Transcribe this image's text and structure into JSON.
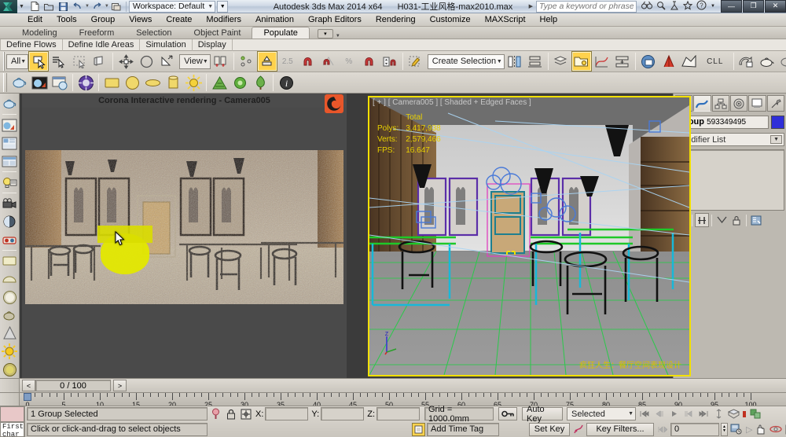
{
  "titlebar": {
    "app_title": "Autodesk 3ds Max  2014 x64",
    "file_name": "H031-工业风格-max2010.max",
    "workspace_label": "Workspace: Default",
    "search_placeholder": "Type a keyword or phrase",
    "quick_access": [
      {
        "name": "new-file-icon",
        "glyph": "🗋"
      },
      {
        "name": "open-file-icon",
        "glyph": "🗁"
      },
      {
        "name": "save-file-icon",
        "glyph": "💾"
      },
      {
        "name": "undo-icon",
        "glyph": "↰"
      },
      {
        "name": "redo-icon",
        "glyph": "↱"
      },
      {
        "name": "project-folder-icon",
        "glyph": "🗐"
      }
    ],
    "help_icons": [
      {
        "name": "binoculars-icon",
        "glyph": "👓"
      },
      {
        "name": "magnifier-icon",
        "glyph": "🔍"
      },
      {
        "name": "subscription-icon",
        "glyph": "⚗"
      },
      {
        "name": "favorite-star-icon",
        "glyph": "☆"
      },
      {
        "name": "help-icon",
        "glyph": "?"
      }
    ],
    "window_buttons": [
      {
        "name": "minimize-button",
        "glyph": "—"
      },
      {
        "name": "maximize-button",
        "glyph": "❐"
      },
      {
        "name": "close-button",
        "glyph": "✕"
      }
    ]
  },
  "menu": {
    "items": [
      "Edit",
      "Tools",
      "Group",
      "Views",
      "Create",
      "Modifiers",
      "Animation",
      "Graph Editors",
      "Rendering",
      "Customize",
      "MAXScript",
      "Help"
    ]
  },
  "ribbon": {
    "tabs": [
      "Modeling",
      "Freeform",
      "Selection",
      "Object Paint",
      "Populate"
    ],
    "active_tab": "Populate",
    "sub_tabs": [
      "Define Flows",
      "Define Idle Areas",
      "Simulation",
      "Display"
    ]
  },
  "toolbar": {
    "selection_filter": "All",
    "reference_coord": "View",
    "named_selection_set": "Create Selection Set",
    "snap_label": "2.5",
    "percent_label": "%",
    "text_tool_label": "CLL",
    "items": [
      {
        "name": "select-object-icon",
        "active": true
      },
      {
        "name": "select-by-name-icon",
        "active": false
      },
      {
        "name": "rectangular-select-region-icon",
        "active": false
      },
      {
        "name": "window-crossing-icon",
        "active": false
      },
      {
        "name": "select-and-move-icon",
        "active": false
      },
      {
        "name": "select-and-rotate-icon",
        "active": false
      },
      {
        "name": "select-and-scale-icon",
        "active": false
      },
      {
        "name": "use-pivot-center-icon",
        "active": false
      },
      {
        "name": "select-and-manipulate-icon",
        "active": true
      },
      {
        "name": "snaps-toggle-icon",
        "active": false
      },
      {
        "name": "angle-snap-icon",
        "active": false
      },
      {
        "name": "percent-snap-icon",
        "active": false
      },
      {
        "name": "spinner-snap-icon",
        "active": false
      },
      {
        "name": "edit-named-selection-icon",
        "active": false
      },
      {
        "name": "mirror-icon",
        "active": false
      },
      {
        "name": "align-icon",
        "active": false
      },
      {
        "name": "layer-manager-icon",
        "active": false
      },
      {
        "name": "scene-explorer-icon",
        "active": true
      },
      {
        "name": "curve-editor-icon",
        "active": false
      },
      {
        "name": "schematic-view-icon",
        "active": false
      },
      {
        "name": "material-editor-icon",
        "active": false
      },
      {
        "name": "render-setup-icon",
        "active": false
      },
      {
        "name": "render-frame-window-icon",
        "active": false
      },
      {
        "name": "render-production-icon",
        "active": false
      },
      {
        "name": "render-iterative-icon",
        "active": false
      },
      {
        "name": "activeshade-icon",
        "active": false
      }
    ]
  },
  "toolbar2": {
    "items": [
      {
        "name": "teapot-primitive-icon"
      },
      {
        "name": "render-preview-icon"
      },
      {
        "name": "render-settings-icon"
      },
      {
        "name": "corona-renderer-icon"
      },
      {
        "name": "box-primitive-icon"
      },
      {
        "name": "sphere-primitive-icon"
      },
      {
        "name": "plane-primitive-icon"
      },
      {
        "name": "cylinder-primitive-icon"
      },
      {
        "name": "omni-light-icon"
      },
      {
        "name": "cone-foliage-icon"
      },
      {
        "name": "foliage-icon"
      },
      {
        "name": "tree-icon"
      },
      {
        "name": "info-icon"
      }
    ]
  },
  "left_toolbar": {
    "items": [
      {
        "name": "teapot-tool-icon"
      },
      {
        "name": "render-frame-tool-icon"
      },
      {
        "name": "material-browser-icon"
      },
      {
        "name": "batch-render-icon"
      },
      {
        "name": "light-lister-icon"
      },
      {
        "name": "camera-tool-icon"
      },
      {
        "name": "daylight-system-icon"
      },
      {
        "name": "vr-camera-icon"
      },
      {
        "name": "plane-tool-icon"
      },
      {
        "name": "dome-tool-icon"
      },
      {
        "name": "sphere-tool-icon"
      },
      {
        "name": "teapot-alt-icon"
      },
      {
        "name": "cone-tool-icon"
      },
      {
        "name": "sun-light-icon"
      },
      {
        "name": "sphere-light-icon"
      }
    ]
  },
  "corona_window": {
    "title": "Corona Interactive rendering - Camera005",
    "logo_name": "corona-logo-icon"
  },
  "viewport": {
    "label": "[ + ] [ Camera005 ] [ Shaded + Edged Faces ]",
    "stats": [
      {
        "label": "",
        "value": "Total"
      },
      {
        "label": "Polys:",
        "value": "3,417,938"
      },
      {
        "label": "Verts:",
        "value": "2,579,466"
      },
      {
        "label": "FPS:",
        "value": "16.647"
      }
    ],
    "watermark": "疯狂人生：餐厅空间表现设计",
    "axis_labels": [
      "Z",
      "Y",
      "X"
    ],
    "border_color": "#f2e000"
  },
  "command_panel": {
    "tabs": [
      {
        "name": "create-tab",
        "glyph": "✹"
      },
      {
        "name": "modify-tab",
        "glyph": "⌒"
      },
      {
        "name": "hierarchy-tab",
        "glyph": "⊞"
      },
      {
        "name": "motion-tab",
        "glyph": "◎"
      },
      {
        "name": "display-tab",
        "glyph": "▣"
      },
      {
        "name": "utilities-tab",
        "glyph": "🔨"
      }
    ],
    "active_tab": "modify-tab",
    "object_name_prefix": "Group",
    "object_name": "593349495",
    "object_color": "#2f2fd8",
    "modifier_list_label": "Modifier List",
    "stack_buttons": [
      {
        "name": "pin-stack-icon"
      },
      {
        "name": "show-end-result-icon"
      },
      {
        "name": "make-unique-icon"
      },
      {
        "name": "remove-modifier-icon"
      },
      {
        "name": "configure-modifier-sets-icon"
      }
    ]
  },
  "timeline": {
    "current_frame": "0 / 100",
    "prev_frame_glyph": "<",
    "next_frame_glyph": ">",
    "ruler_labels": [
      "0",
      "5",
      "10",
      "15",
      "20",
      "25",
      "30",
      "35",
      "40",
      "45",
      "50",
      "55",
      "60",
      "65",
      "70",
      "75",
      "80",
      "85",
      "90",
      "95",
      "100"
    ]
  },
  "statusbar": {
    "listener_text": "First char",
    "selection_status": "1 Group Selected",
    "prompt": "Click or click-and-drag to select objects",
    "coord_labels": {
      "x": "X:",
      "y": "Y:",
      "z": "Z:"
    },
    "coord_values": {
      "x": "",
      "y": "",
      "z": ""
    },
    "grid_label": "Grid = 1000.0mm",
    "add_time_tag": "Add Time Tag",
    "auto_key": "Auto Key",
    "set_key": "Set Key",
    "key_mode": "Selected",
    "key_filters": "Key Filters...",
    "key_value": "0",
    "icons": [
      {
        "name": "isolate-selection-icon"
      },
      {
        "name": "selection-lock-icon"
      },
      {
        "name": "absolute-relative-toggle-icon"
      },
      {
        "name": "key-mode-toggle-icon"
      },
      {
        "name": "set-key-filters-icon"
      }
    ],
    "nav_icons": [
      {
        "name": "go-to-start-icon",
        "glyph": "|◀◀"
      },
      {
        "name": "previous-frame-icon",
        "glyph": "◀||"
      },
      {
        "name": "play-animation-icon",
        "glyph": "▶"
      },
      {
        "name": "next-frame-icon",
        "glyph": "||▶"
      },
      {
        "name": "go-to-end-icon",
        "glyph": "▶▶|"
      },
      {
        "name": "key-mode-icon",
        "glyph": "|◀◀"
      }
    ],
    "view_icons": [
      {
        "name": "zoom-icon"
      },
      {
        "name": "zoom-all-icon"
      },
      {
        "name": "zoom-extents-icon"
      },
      {
        "name": "field-of-view-icon"
      },
      {
        "name": "pan-view-icon"
      },
      {
        "name": "orbit-icon"
      },
      {
        "name": "maximize-viewport-icon"
      }
    ]
  }
}
